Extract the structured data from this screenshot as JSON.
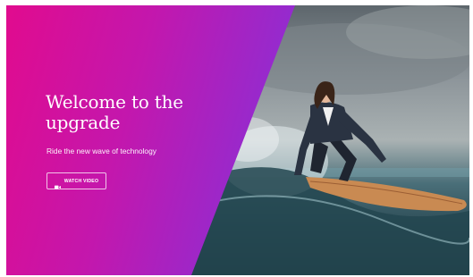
{
  "hero": {
    "title": "Welcome to the upgrade",
    "subtitle": "Ride the new wave of technology",
    "cta_label": "WATCH VIDEO",
    "cta_icon": "video-camera-icon"
  },
  "colors": {
    "gradient_start": "#e10b8e",
    "gradient_end": "#4f4fe8",
    "text": "#ffffff"
  }
}
